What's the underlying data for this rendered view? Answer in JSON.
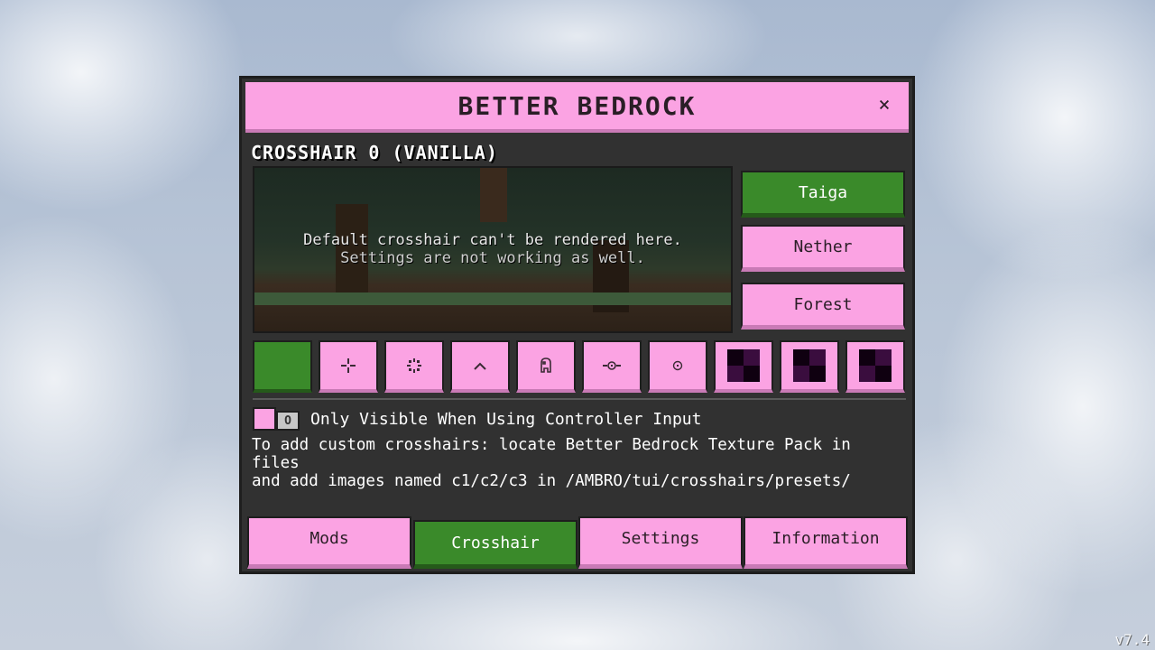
{
  "dialog": {
    "title": "BETTER BEDROCK",
    "close_label": "×"
  },
  "section_title": "CROSSHAIR 0 (VANILLA)",
  "preview": {
    "line1": "Default crosshair can't be rendered here.",
    "line2": "Settings are not working as well."
  },
  "themes": [
    {
      "label": "Taiga",
      "active": true
    },
    {
      "label": "Nether",
      "active": false
    },
    {
      "label": "Forest",
      "active": false
    }
  ],
  "crosshair_swatches": [
    {
      "icon": "selected-color-swatch"
    },
    {
      "icon": "crosshair-plus-icon"
    },
    {
      "icon": "crosshair-dotted-icon"
    },
    {
      "icon": "crosshair-caret-icon"
    },
    {
      "icon": "crosshair-creature-icon"
    },
    {
      "icon": "crosshair-line-dot-icon"
    },
    {
      "icon": "crosshair-circle-dot-icon"
    },
    {
      "icon": "custom-preset-icon"
    },
    {
      "icon": "custom-preset-icon"
    },
    {
      "icon": "custom-preset-icon"
    }
  ],
  "controller_toggle": {
    "label": "Only Visible When Using Controller Input",
    "knob_label": "O"
  },
  "info": {
    "line1": "To add custom crosshairs: locate Better Bedrock Texture Pack in files",
    "line2": "and add images named c1/c2/c3 in /AMBRO/tui/crosshairs/presets/"
  },
  "tabs": [
    {
      "label": "Mods",
      "active": false
    },
    {
      "label": "Crosshair",
      "active": true
    },
    {
      "label": "Settings",
      "active": false
    },
    {
      "label": "Information",
      "active": false
    }
  ],
  "version": "v7.4",
  "colors": {
    "accent_pink": "#fba3e3",
    "accent_green": "#3a8a2a",
    "panel": "#313131"
  }
}
